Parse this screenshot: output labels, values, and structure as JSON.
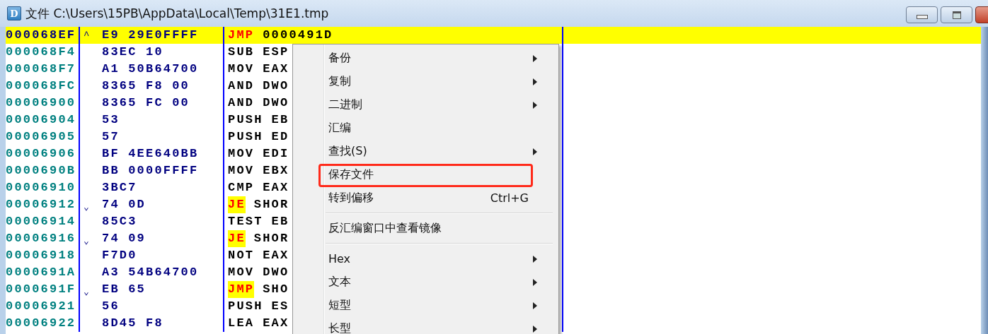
{
  "window": {
    "title": "文件 C:\\Users\\15PB\\AppData\\Local\\Temp\\31E1.tmp",
    "app_icon": "D"
  },
  "rows": [
    {
      "address": "000068EF",
      "mark": "^",
      "hex": "E9 29E0FFFF",
      "mnemonic": "JMP",
      "operand": "0000491D",
      "jump": true,
      "selected": true
    },
    {
      "address": "000068F4",
      "mark": "",
      "hex": "83EC 10",
      "mnemonic": "SUB",
      "operand": "ESP",
      "jump": false,
      "selected": false
    },
    {
      "address": "000068F7",
      "mark": "",
      "hex": "A1 50B64700",
      "mnemonic": "MOV",
      "operand": "EAX",
      "jump": false,
      "selected": false
    },
    {
      "address": "000068FC",
      "mark": "",
      "hex": "8365 F8 00",
      "mnemonic": "AND",
      "operand": "DWO",
      "jump": false,
      "selected": false
    },
    {
      "address": "00006900",
      "mark": "",
      "hex": "8365 FC 00",
      "mnemonic": "AND",
      "operand": "DWO",
      "jump": false,
      "selected": false
    },
    {
      "address": "00006904",
      "mark": "",
      "hex": "53",
      "mnemonic": "PUSH",
      "operand": "EB",
      "jump": false,
      "selected": false
    },
    {
      "address": "00006905",
      "mark": "",
      "hex": "57",
      "mnemonic": "PUSH",
      "operand": "ED",
      "jump": false,
      "selected": false
    },
    {
      "address": "00006906",
      "mark": "",
      "hex": "BF 4EE640BB",
      "mnemonic": "MOV",
      "operand": "EDI",
      "jump": false,
      "selected": false
    },
    {
      "address": "0000690B",
      "mark": "",
      "hex": "BB 0000FFFF",
      "mnemonic": "MOV",
      "operand": "EBX",
      "jump": false,
      "selected": false
    },
    {
      "address": "00006910",
      "mark": "",
      "hex": "3BC7",
      "mnemonic": "CMP",
      "operand": "EAX",
      "jump": false,
      "selected": false
    },
    {
      "address": "00006912",
      "mark": "⌄",
      "hex": "74 0D",
      "mnemonic": "JE",
      "operand": "SHOR",
      "jump": true,
      "selected": false
    },
    {
      "address": "00006914",
      "mark": "",
      "hex": "85C3",
      "mnemonic": "TEST",
      "operand": "EB",
      "jump": false,
      "selected": false
    },
    {
      "address": "00006916",
      "mark": "⌄",
      "hex": "74 09",
      "mnemonic": "JE",
      "operand": "SHOR",
      "jump": true,
      "selected": false
    },
    {
      "address": "00006918",
      "mark": "",
      "hex": "F7D0",
      "mnemonic": "NOT",
      "operand": "EAX",
      "jump": false,
      "selected": false
    },
    {
      "address": "0000691A",
      "mark": "",
      "hex": "A3 54B64700",
      "mnemonic": "MOV",
      "operand": "DWO",
      "jump": false,
      "selected": false
    },
    {
      "address": "0000691F",
      "mark": "⌄",
      "hex": "EB 65",
      "mnemonic": "JMP",
      "operand": "SHO",
      "jump": true,
      "selected": false
    },
    {
      "address": "00006921",
      "mark": "",
      "hex": "56",
      "mnemonic": "PUSH",
      "operand": "ES",
      "jump": false,
      "selected": false
    },
    {
      "address": "00006922",
      "mark": "",
      "hex": "8D45 F8",
      "mnemonic": "LEA",
      "operand": "EAX",
      "jump": false,
      "selected": false
    }
  ],
  "context_menu": {
    "groups": [
      [
        {
          "label": "备份",
          "submenu": true,
          "annotated": false
        },
        {
          "label": "复制",
          "submenu": true,
          "annotated": false
        },
        {
          "label": "二进制",
          "submenu": true,
          "annotated": false
        },
        {
          "label": "汇编",
          "submenu": false,
          "annotated": false
        },
        {
          "label": "查找(S)",
          "submenu": true,
          "annotated": false
        },
        {
          "label": "保存文件",
          "submenu": false,
          "annotated": true
        },
        {
          "label": "转到偏移",
          "shortcut": "Ctrl+G",
          "submenu": false,
          "annotated": false
        }
      ],
      [
        {
          "label": "反汇编窗口中查看镜像",
          "submenu": false,
          "annotated": false
        }
      ],
      [
        {
          "label": "Hex",
          "submenu": true,
          "annotated": false
        },
        {
          "label": "文本",
          "submenu": true,
          "annotated": false
        },
        {
          "label": "短型",
          "submenu": true,
          "annotated": false
        },
        {
          "label": "长型",
          "submenu": true,
          "annotated": false
        }
      ]
    ]
  }
}
